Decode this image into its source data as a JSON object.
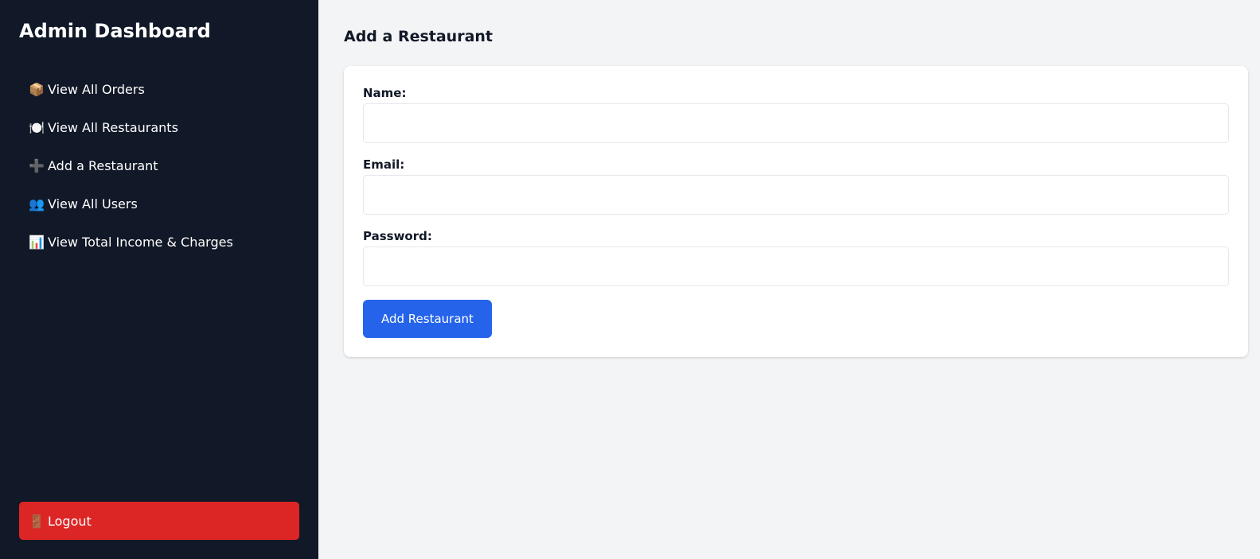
{
  "sidebar": {
    "title": "Admin Dashboard",
    "items": [
      {
        "icon": "📦",
        "label": "View All Orders"
      },
      {
        "icon": "🍽️",
        "label": "View All Restaurants"
      },
      {
        "icon": "➕",
        "label": "Add a Restaurant"
      },
      {
        "icon": "👥",
        "label": "View All Users"
      },
      {
        "icon": "📊",
        "label": "View Total Income & Charges"
      }
    ],
    "logout": {
      "icon": "🚪",
      "label": "Logout"
    }
  },
  "main": {
    "title": "Add a Restaurant",
    "form": {
      "name_label": "Name:",
      "name_value": "",
      "email_label": "Email:",
      "email_value": "",
      "password_label": "Password:",
      "password_value": "",
      "submit_label": "Add Restaurant"
    }
  },
  "colors": {
    "sidebar_bg": "#111827",
    "logout_bg": "#dc2626",
    "primary_button": "#2563eb",
    "page_bg": "#f3f4f6"
  }
}
